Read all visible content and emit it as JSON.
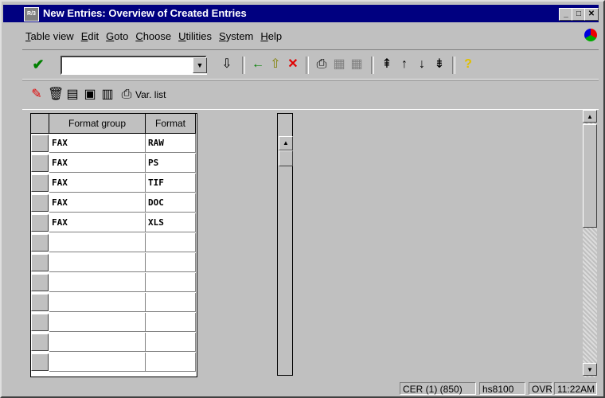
{
  "window": {
    "title": "New Entries: Overview of Created Entries",
    "app_icon": "R/3"
  },
  "menu": [
    {
      "u": "T",
      "rest": "able view"
    },
    {
      "u": "E",
      "rest": "dit"
    },
    {
      "u": "G",
      "rest": "oto"
    },
    {
      "u": "C",
      "rest": "hoose"
    },
    {
      "u": "U",
      "rest": "tilities"
    },
    {
      "u": "S",
      "rest": "ystem"
    },
    {
      "u": "H",
      "rest": "elp"
    }
  ],
  "toolbar": {
    "command_value": "",
    "var_list_label": "Var. list"
  },
  "table": {
    "headers": [
      "Format group",
      "Format"
    ],
    "rows": [
      [
        "FAX",
        "RAW"
      ],
      [
        "FAX",
        "PS"
      ],
      [
        "FAX",
        "TIF"
      ],
      [
        "FAX",
        "DOC"
      ],
      [
        "FAX",
        "XLS"
      ],
      [
        "",
        ""
      ],
      [
        "",
        ""
      ],
      [
        "",
        ""
      ],
      [
        "",
        ""
      ],
      [
        "",
        ""
      ],
      [
        "",
        ""
      ],
      [
        "",
        ""
      ]
    ]
  },
  "status": {
    "system": "CER (1) (850)",
    "server": "hs8100",
    "mode": "OVR",
    "time": "11:22AM"
  },
  "colors": {
    "titlebar": "#000080",
    "chrome": "#c0c0c0",
    "check": "#008000",
    "cancel": "#e00000",
    "help": "#e0c000"
  }
}
